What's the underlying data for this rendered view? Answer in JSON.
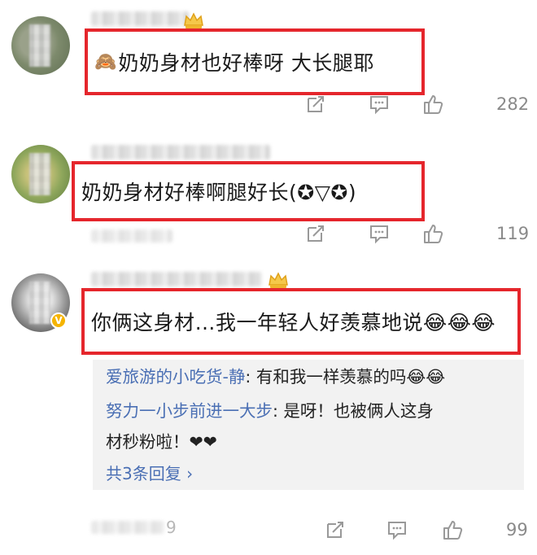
{
  "comments": [
    {
      "text": "奶奶身材也好棒呀 大长腿耶",
      "emoji_prefix": "🙈",
      "like_count": "282"
    },
    {
      "text": "奶奶身材好棒啊腿好长(✪▽✪)",
      "like_count": "119"
    },
    {
      "text": "你俩这身材…我一年轻人好羡慕地说😂😂😂",
      "like_count": "99",
      "replies": [
        {
          "user": "爱旅游的小吃货-静",
          "text": ": 有和我一样羡慕的吗😂😂"
        },
        {
          "user": "努力一小步前进一大步",
          "text": ": 是呀！也被俩人这身",
          "text_cont": "材秒粉啦！❤❤"
        }
      ],
      "more_replies_label": "共3条回复 ›",
      "time_partial": "9"
    }
  ],
  "icons": {
    "share": "share-icon",
    "comment": "comment-icon",
    "like": "thumbs-up-icon"
  },
  "colors": {
    "highlight_border": "#e5262c",
    "reply_user": "#4a6fb4",
    "count_gray": "#8a8a8a"
  }
}
